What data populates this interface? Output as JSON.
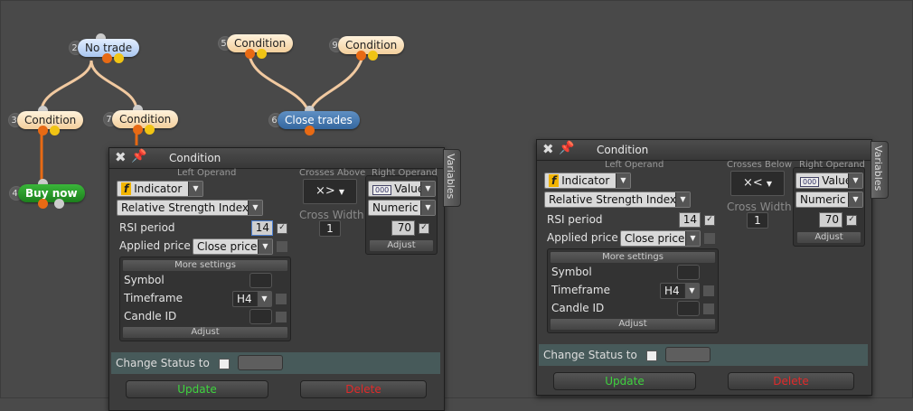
{
  "nodes": {
    "no_trade": {
      "num": "2",
      "label": "No trade"
    },
    "c5": {
      "num": "5",
      "label": "Condition"
    },
    "c9": {
      "num": "9",
      "label": "Condition"
    },
    "c3": {
      "num": "3",
      "label": "Condition"
    },
    "c7": {
      "num": "7",
      "label": "Condition"
    },
    "close": {
      "num": "6",
      "label": "Close trades"
    },
    "buy": {
      "num": "4",
      "label": "Buy now"
    }
  },
  "dialogs": [
    {
      "title": "Condition",
      "variables_tab": "Variables",
      "left_operand_header": "Left Operand",
      "indicator_type": "Indicator",
      "indicator_name": "Relative Strength Index",
      "rsi_label": "RSI period",
      "rsi_value": "14",
      "applied_label": "Applied price",
      "applied_value": "Close price",
      "more_settings": "More settings",
      "symbol_label": "Symbol",
      "timeframe_label": "Timeframe",
      "timeframe_value": "H4",
      "candle_label": "Candle ID",
      "adjust_left": "Adjust",
      "cross_header": "Crosses Above",
      "cross_symbol": "×>",
      "cross_width_label": "Cross Width",
      "cross_width_value": "1",
      "right_operand_header": "Right Operand",
      "right_type": "Value",
      "right_kind": "Numeric",
      "right_value": "70",
      "adjust_right": "Adjust",
      "status_label": "Change Status to",
      "update_label": "Update",
      "delete_label": "Delete"
    },
    {
      "title": "Condition",
      "variables_tab": "Variables",
      "left_operand_header": "Left Operand",
      "indicator_type": "Indicator",
      "indicator_name": "Relative Strength Index",
      "rsi_label": "RSI period",
      "rsi_value": "14",
      "applied_label": "Applied price",
      "applied_value": "Close price",
      "more_settings": "More settings",
      "symbol_label": "Symbol",
      "timeframe_label": "Timeframe",
      "timeframe_value": "H4",
      "candle_label": "Candle ID",
      "adjust_left": "Adjust",
      "cross_header": "Crosses Below",
      "cross_symbol": "×<",
      "cross_width_label": "Cross Width",
      "cross_width_value": "1",
      "right_operand_header": "Right Operand",
      "right_type": "Value",
      "right_kind": "Numeric",
      "right_value": "70",
      "adjust_right": "Adjust",
      "status_label": "Change Status to",
      "update_label": "Update",
      "delete_label": "Delete"
    }
  ],
  "colors": {
    "canvas": "#494949",
    "wire": "#e86a14",
    "update": "#3fd33f",
    "delete": "#e02a2a"
  }
}
